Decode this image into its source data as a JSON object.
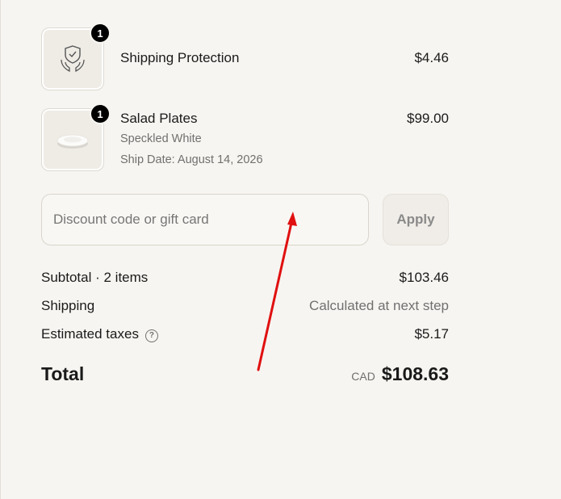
{
  "line_items": [
    {
      "icon": "shield-hands-icon",
      "quantity": "1",
      "name": "Shipping Protection",
      "price": "$4.46"
    },
    {
      "icon": "plate-image",
      "quantity": "1",
      "name": "Salad Plates",
      "variant": "Speckled White",
      "ship_date": "Ship Date: August 14, 2026",
      "price": "$99.00"
    }
  ],
  "discount": {
    "placeholder": "Discount code or gift card",
    "value": "",
    "apply_label": "Apply"
  },
  "summary": {
    "subtotal_label": "Subtotal · 2 items",
    "subtotal_value": "$103.46",
    "shipping_label": "Shipping",
    "shipping_value": "Calculated at next step",
    "taxes_label": "Estimated taxes",
    "taxes_help_icon": "question-circle-icon",
    "taxes_value": "$5.17",
    "total_label": "Total",
    "currency": "CAD",
    "total_value": "$108.63"
  },
  "annotation": {
    "arrow_color": "#e01010"
  }
}
